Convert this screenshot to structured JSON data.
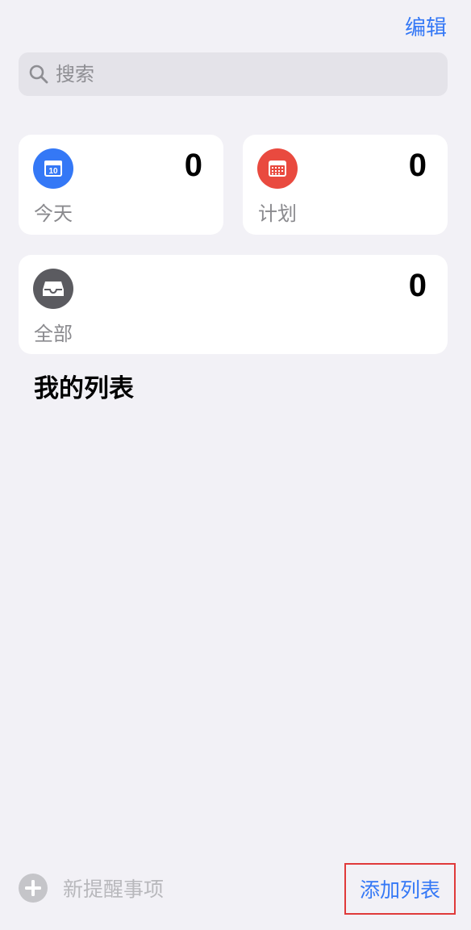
{
  "header": {
    "edit_label": "编辑"
  },
  "search": {
    "placeholder": "搜索"
  },
  "smart_lists": [
    {
      "label": "今天",
      "count": "0",
      "color": "#3478f6",
      "icon": "calendar-today-icon",
      "day": "10"
    },
    {
      "label": "计划",
      "count": "0",
      "color": "#e94a3f",
      "icon": "calendar-grid-icon"
    },
    {
      "label": "全部",
      "count": "0",
      "color": "#5b5b60",
      "icon": "tray-icon"
    }
  ],
  "my_lists": {
    "title": "我的列表"
  },
  "toolbar": {
    "new_reminder_label": "新提醒事项",
    "add_list_label": "添加列表"
  },
  "colors": {
    "accent": "#3478f6",
    "background": "#f2f1f6"
  }
}
